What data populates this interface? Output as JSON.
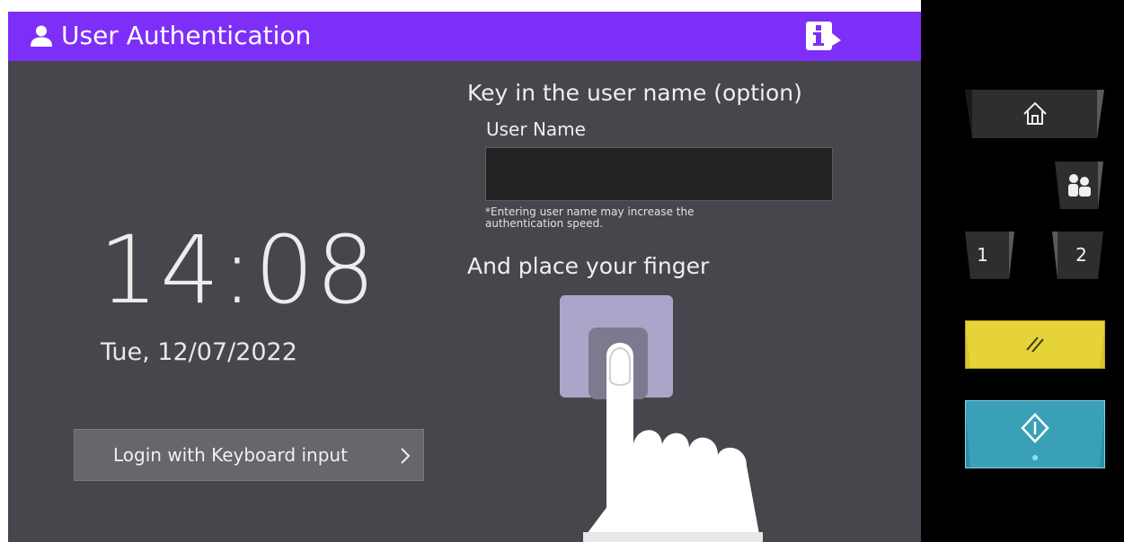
{
  "header": {
    "title": "User Authentication",
    "user_icon": "user-icon",
    "info_icon": "info-icon",
    "accent_color": "#7e2ff7"
  },
  "clock": {
    "time": "14:08",
    "date": "Tue, 12/07/2022"
  },
  "keyboard_login": {
    "label": "Login with Keyboard input",
    "chevron_icon": "chevron-right-icon"
  },
  "username": {
    "heading": "Key in the user name (option)",
    "label": "User Name",
    "value": "",
    "note": "*Entering user name may increase the authentication speed."
  },
  "fingerprint": {
    "heading": "And place your finger",
    "illustration_icon": "fingerprint-reader-icon"
  },
  "hardware_panel": {
    "home_icon": "home-icon",
    "user_switch_icon": "users-icon",
    "key_1": "1",
    "key_2": "2",
    "reset_icon": "reset-icon",
    "reset_color": "#d6c42a",
    "start_icon": "start-icon",
    "start_color": "#2a8fa6"
  }
}
